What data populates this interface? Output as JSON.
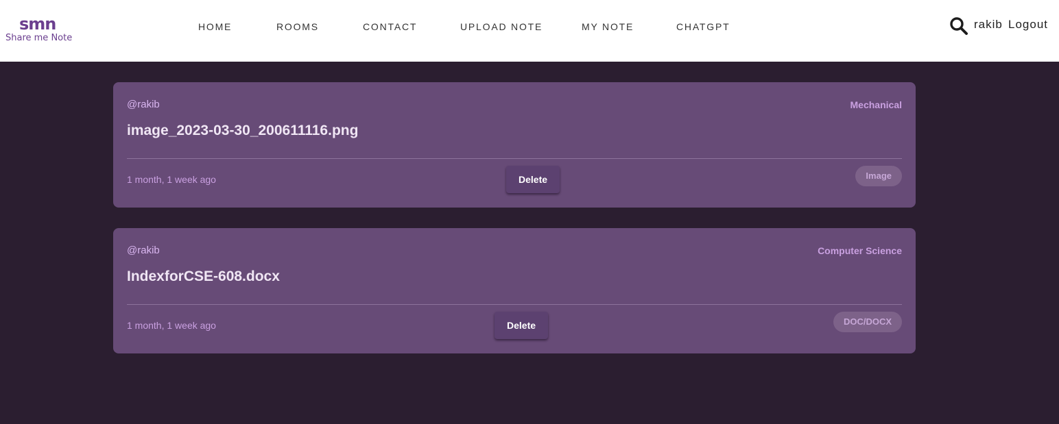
{
  "brand": {
    "mark": "smn",
    "name": "Share me Note",
    "color": "#6b3f8f"
  },
  "nav": {
    "items": [
      "HOME",
      "ROOMS",
      "CONTACT",
      "UPLOAD NOTE",
      "MY NOTE",
      "CHATGPT"
    ]
  },
  "user": {
    "name": "rakib",
    "logout_label": "Logout",
    "search_icon": "search-icon"
  },
  "notes": [
    {
      "user": "@rakib",
      "room": "Mechanical",
      "title": "image_2023-03-30_200611116.png",
      "time": "1 month, 1 week ago",
      "delete_label": "Delete",
      "type": "Image"
    },
    {
      "user": "@rakib",
      "room": "Computer Science",
      "title": "IndexforCSE-608.docx",
      "time": "1 month, 1 week ago",
      "delete_label": "Delete",
      "type": "DOC/DOCX"
    }
  ],
  "colors": {
    "page_bg": "#2b1e30",
    "card_bg": "#674b77",
    "accent": "#c9a0e0"
  }
}
